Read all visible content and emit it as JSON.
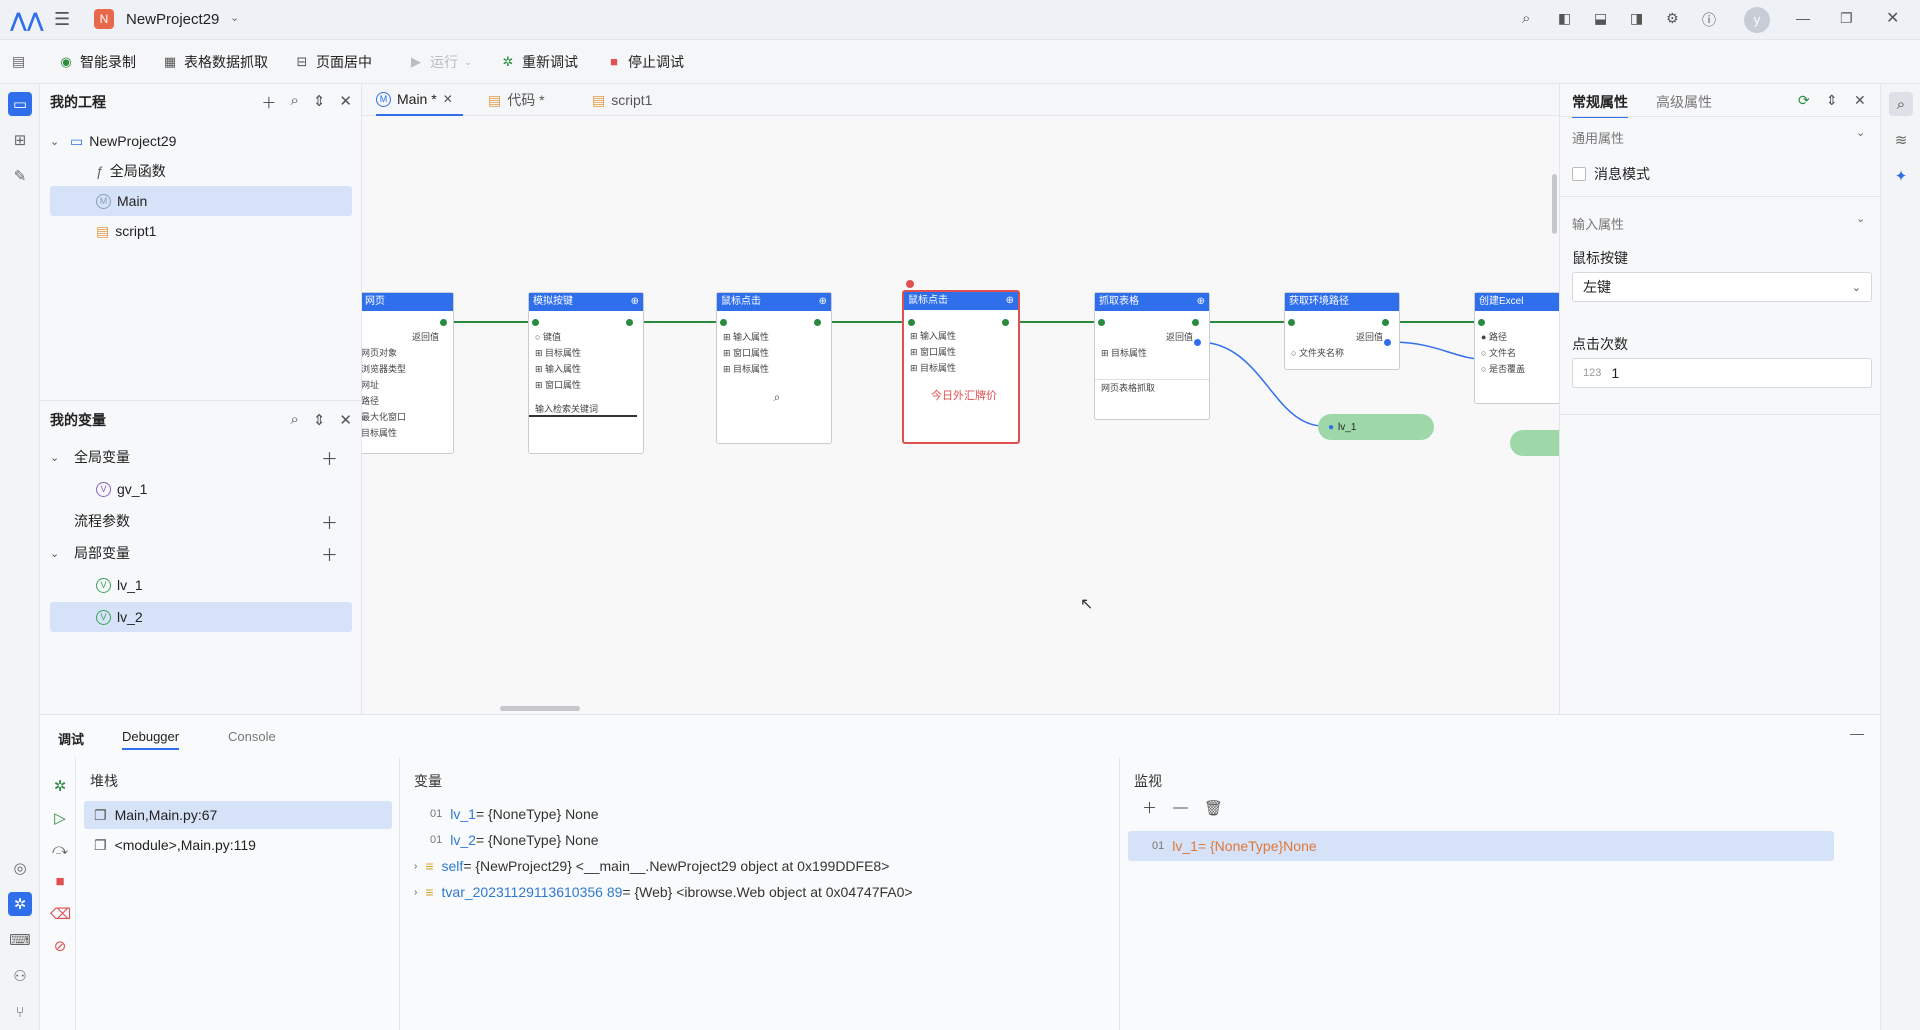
{
  "titlebar": {
    "project_initial": "N",
    "project_name": "NewProject29",
    "user_initial": "y"
  },
  "toolbar": {
    "smart_record": "智能录制",
    "table_capture": "表格数据抓取",
    "page_center": "页面居中",
    "run": "运行",
    "rerun_debug": "重新调试",
    "stop_debug": "停止调试"
  },
  "project_panel": {
    "title": "我的工程",
    "root": "NewProject29",
    "items": [
      "全局函数",
      "Main",
      "script1"
    ]
  },
  "variables_panel": {
    "title": "我的变量",
    "global_vars": "全局变量",
    "global_items": [
      "gv_1"
    ],
    "flow_params": "流程参数",
    "local_vars": "局部变量",
    "local_items": [
      "lv_1",
      "lv_2"
    ]
  },
  "editor_tabs": [
    {
      "label": "Main *"
    },
    {
      "label": "代码 *"
    },
    {
      "label": "script1"
    }
  ],
  "flow_nodes": [
    {
      "title": "网页",
      "rows": [
        "返回值",
        "网页对象",
        "浏览器类型",
        "网址",
        "路径",
        "最大化窗口",
        "目标属性"
      ]
    },
    {
      "title": "模拟按键",
      "rows": [
        "键值",
        "目标属性",
        "输入属性",
        "窗口属性"
      ],
      "footer": "输入检索关键词"
    },
    {
      "title": "鼠标点击",
      "rows": [
        "输入属性",
        "窗口属性",
        "目标属性"
      ]
    },
    {
      "title": "鼠标点击",
      "rows": [
        "输入属性",
        "窗口属性",
        "目标属性"
      ],
      "footer": "今日外汇牌价"
    },
    {
      "title": "抓取表格",
      "rows": [
        "返回值",
        "目标属性"
      ],
      "footer": "网页表格抓取"
    },
    {
      "title": "获取环境路径",
      "rows": [
        "返回值",
        "文件夹名称"
      ]
    },
    {
      "title": "创建Excel",
      "rows": [
        "路径",
        "文件名",
        "是否覆盖"
      ]
    }
  ],
  "var_pill": "lv_1",
  "properties": {
    "tab_general": "常规属性",
    "tab_advanced": "高级属性",
    "section_common": "通用属性",
    "message_mode": "消息模式",
    "section_input": "输入属性",
    "mouse_button_label": "鼠标按键",
    "mouse_button_value": "左键",
    "click_count_label": "点击次数",
    "click_count_value": "1"
  },
  "debug": {
    "title": "调试",
    "tab_debugger": "Debugger",
    "tab_console": "Console",
    "stack_header": "堆栈",
    "stack": [
      "Main,Main.py:67",
      "<module>,Main.py:119"
    ],
    "vars_header": "变量",
    "vars": [
      {
        "name": "lv_1",
        "value": " = {NoneType} None"
      },
      {
        "name": "lv_2",
        "value": " = {NoneType} None"
      },
      {
        "name": "self",
        "value": " = {NewProject29} <__main__.NewProject29 object at 0x199DDFE8>"
      },
      {
        "name": "tvar_20231129113610356 89",
        "value": " = {Web} <ibrowse.Web object at 0x04747FA0>"
      }
    ],
    "watch_header": "监视",
    "watch": [
      {
        "name": "lv_1",
        "value": " = {NoneType}None"
      }
    ]
  },
  "colors": {
    "accent": "#2f6fec",
    "selected": "#d6e2f7",
    "node_header": "#2f6fec",
    "error": "#e05050"
  }
}
